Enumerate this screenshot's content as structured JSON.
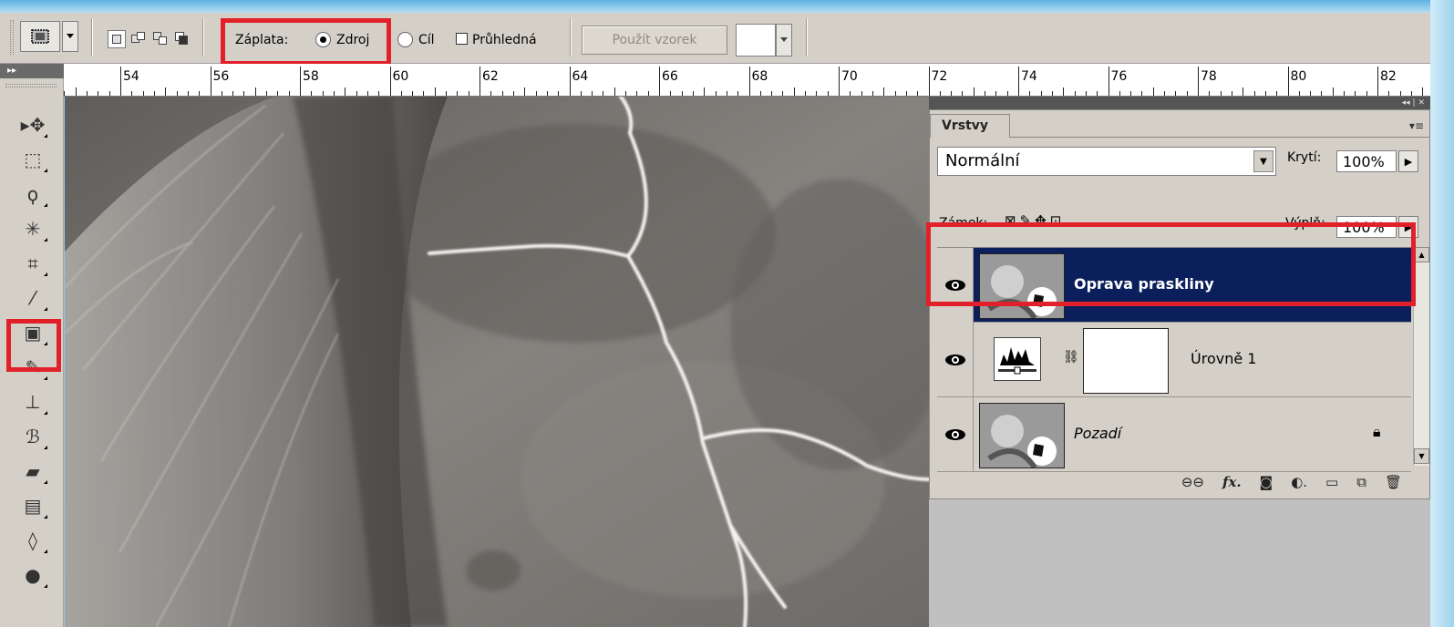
{
  "options_bar": {
    "patch_label": "Záplata:",
    "source_label": "Zdroj",
    "dest_label": "Cíl",
    "transparent_label": "Průhledná",
    "use_pattern_button": "Použít vzorek",
    "source_selected": true,
    "transparent_checked": false
  },
  "ruler": {
    "labels": [
      "54",
      "56",
      "58",
      "60",
      "62",
      "64",
      "66",
      "68",
      "70",
      "72",
      "74",
      "76",
      "78",
      "80",
      "82"
    ]
  },
  "toolbox": {
    "tools": [
      {
        "icon": "move-icon",
        "glyph": "▸✥"
      },
      {
        "icon": "marquee-icon",
        "glyph": "⬚"
      },
      {
        "icon": "lasso-icon",
        "glyph": "ϙ"
      },
      {
        "icon": "magic-wand-icon",
        "glyph": "✳"
      },
      {
        "icon": "crop-icon",
        "glyph": "⌗"
      },
      {
        "icon": "eyedropper-icon",
        "glyph": "⁄"
      },
      {
        "icon": "patch-tool-icon",
        "glyph": "▣"
      },
      {
        "icon": "brush-icon",
        "glyph": "✎"
      },
      {
        "icon": "clone-stamp-icon",
        "glyph": "⊥"
      },
      {
        "icon": "history-brush-icon",
        "glyph": "ℬ"
      },
      {
        "icon": "eraser-icon",
        "glyph": "▰"
      },
      {
        "icon": "gradient-icon",
        "glyph": "▤"
      },
      {
        "icon": "blur-icon",
        "glyph": "◊"
      },
      {
        "icon": "dodge-icon",
        "glyph": "●"
      }
    ]
  },
  "layers_panel": {
    "tab_label": "Vrstvy",
    "blend_mode": "Normální",
    "opacity_label": "Krytí:",
    "opacity_value": "100%",
    "lock_label": "Zámek:",
    "fill_label": "Výplň:",
    "fill_value": "100%",
    "layers": [
      {
        "name": "Oprava praskliny",
        "selected": true,
        "italic": false,
        "locked": false
      },
      {
        "name": "Úrovně 1",
        "selected": false,
        "italic": false,
        "locked": false,
        "adjustment": true
      },
      {
        "name": "Pozadí",
        "selected": false,
        "italic": true,
        "locked": true
      }
    ],
    "bottom_icons": [
      "link-icon",
      "fx-icon",
      "mask-icon",
      "adjustment-icon",
      "folder-icon",
      "new-layer-icon",
      "trash-icon"
    ]
  },
  "colors": {
    "highlight": "#e2202a",
    "selected_layer_bg": "#0a1f5c"
  }
}
